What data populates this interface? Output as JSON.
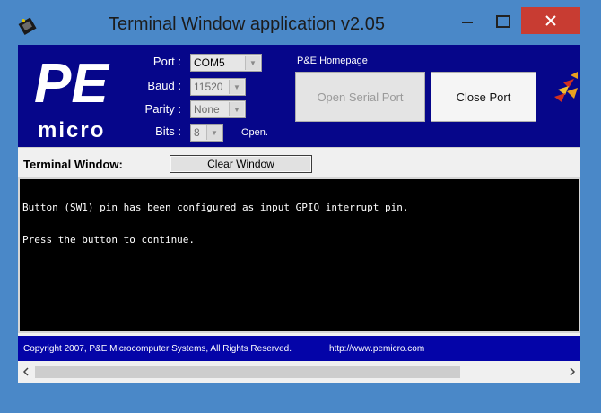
{
  "window": {
    "title": "Terminal Window application v2.05",
    "controls": {
      "minimize": "—",
      "maximize": "☐",
      "close": "✕"
    },
    "accent_color": "#4a88c8",
    "close_color": "#c83c32"
  },
  "header": {
    "background_color": "#06068a",
    "logo_text": "micro",
    "port": {
      "label": "Port :",
      "value": "COM5"
    },
    "baud": {
      "label": "Baud :",
      "value": "11520"
    },
    "parity": {
      "label": "Parity :",
      "value": "None"
    },
    "bits": {
      "label": "Bits :",
      "value": "8"
    },
    "status": "Open.",
    "homepage_link": "P&E Homepage",
    "open_button": "Open Serial Port",
    "close_button": "Close Port"
  },
  "terminal_bar": {
    "label": "Terminal Window:",
    "clear_button": "Clear Window"
  },
  "terminal": {
    "lines": [
      "Button (SW1) pin has been configured as input GPIO interrupt pin.",
      "Press the button to continue."
    ]
  },
  "footer": {
    "copyright": "Copyright 2007, P&E Microcomputer Systems, All Rights Reserved.",
    "url": "http://www.pemicro.com"
  },
  "scrollbar": {
    "left_icon": "chevron-left-icon",
    "right_icon": "chevron-right-icon"
  }
}
